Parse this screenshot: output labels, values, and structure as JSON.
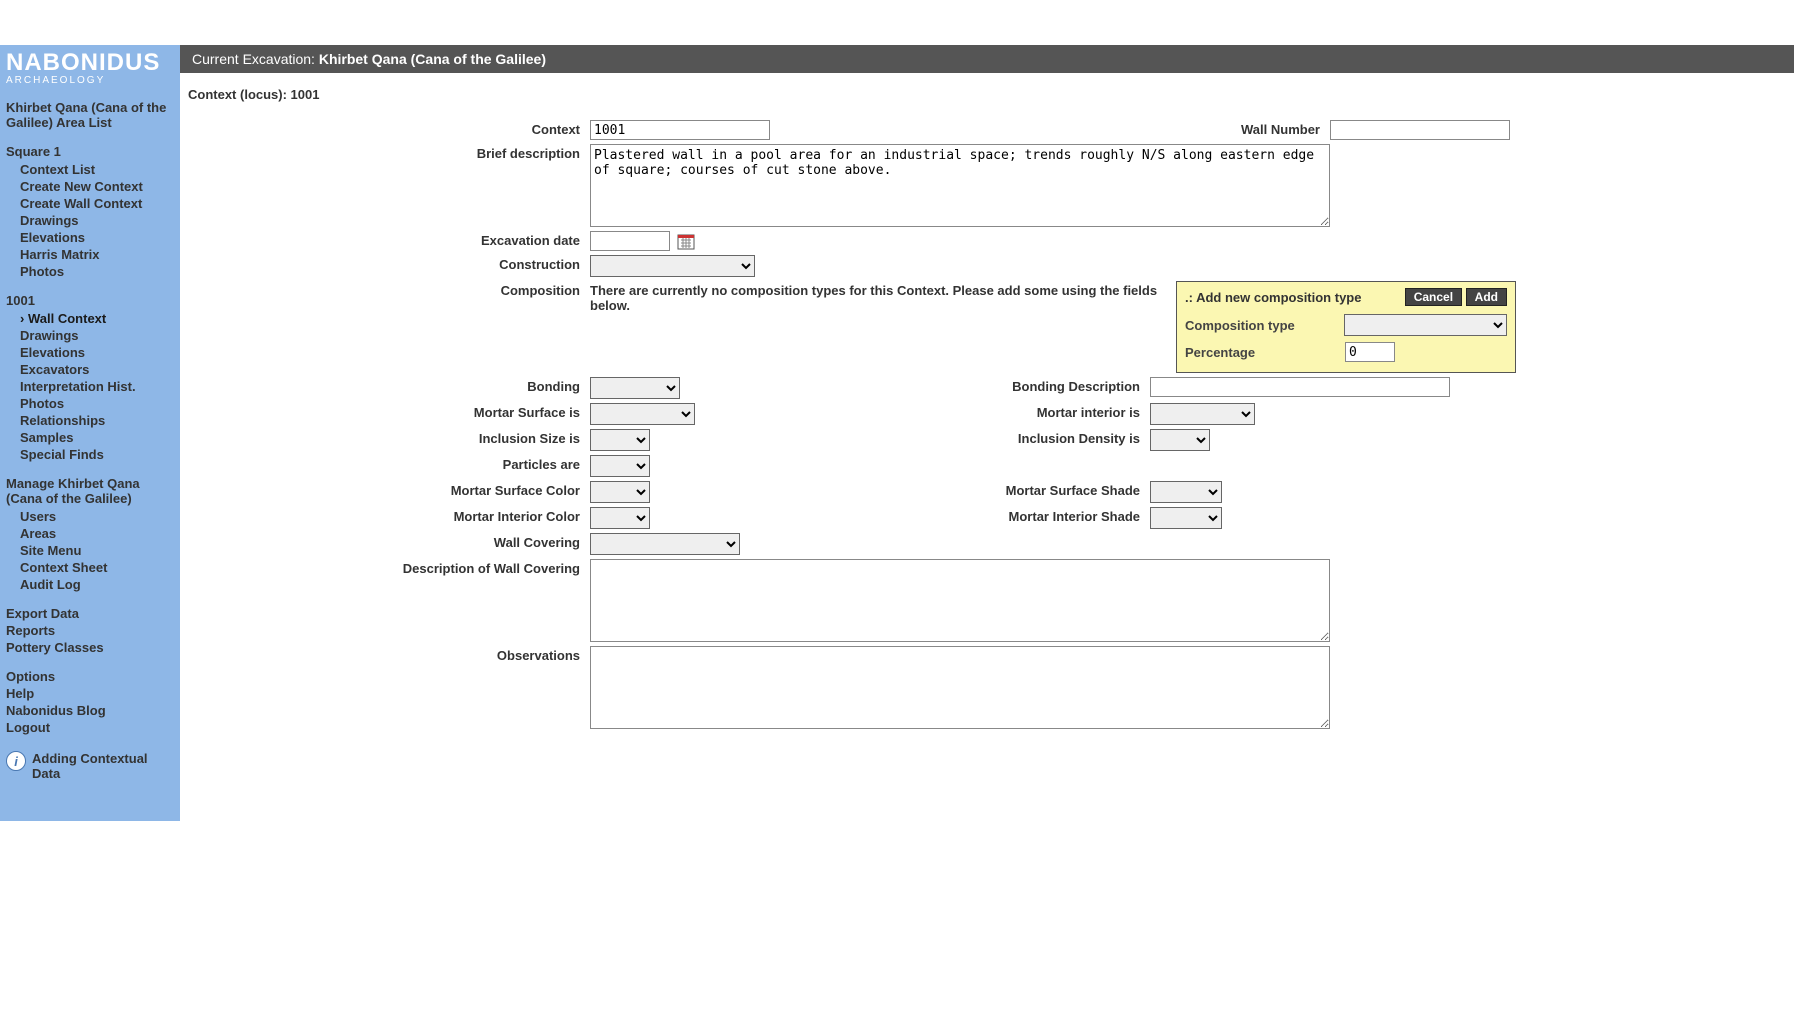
{
  "brand": {
    "name": "NABONIDUS",
    "sub": "ARCHAEOLOGY"
  },
  "topbar": {
    "prefix": "Current Excavation: ",
    "site": "Khirbet Qana (Cana of the Galilee)"
  },
  "context_title": "Context (locus): 1001",
  "sidebar": {
    "area_heading": "Khirbet Qana (Cana of the Galilee) Area List",
    "square_heading": "Square 1",
    "square_links": {
      "context_list": "Context List",
      "create_new_context": "Create New Context",
      "create_wall_context": "Create Wall Context",
      "drawings": "Drawings",
      "elevations": "Elevations",
      "harris_matrix": "Harris Matrix",
      "photos": "Photos"
    },
    "context_heading": "1001",
    "context_links": {
      "wall_context": "Wall Context",
      "drawings": "Drawings",
      "elevations": "Elevations",
      "excavators": "Excavators",
      "interp_hist": "Interpretation Hist.",
      "photos": "Photos",
      "relationships": "Relationships",
      "samples": "Samples",
      "special_finds": "Special Finds"
    },
    "manage_heading": "Manage Khirbet Qana (Cana of the Galilee)",
    "manage_links": {
      "users": "Users",
      "areas": "Areas",
      "site_menu": "Site Menu",
      "context_sheet": "Context Sheet",
      "audit_log": "Audit Log"
    },
    "global_links": {
      "export_data": "Export Data",
      "reports": "Reports",
      "pottery_classes": "Pottery Classes"
    },
    "footer_links": {
      "options": "Options",
      "help": "Help",
      "blog": "Nabonidus Blog",
      "logout": "Logout"
    },
    "info": "Adding Contextual Data"
  },
  "labels": {
    "context": "Context",
    "wall_number": "Wall Number",
    "brief_desc": "Brief description",
    "excavation_date": "Excavation date",
    "construction": "Construction",
    "composition": "Composition",
    "bonding": "Bonding",
    "bonding_desc": "Bonding Description",
    "mortar_surface_is": "Mortar Surface is",
    "mortar_interior_is": "Mortar interior is",
    "inclusion_size": "Inclusion Size is",
    "inclusion_density": "Inclusion Density is",
    "particles_are": "Particles are",
    "mortar_surface_color": "Mortar Surface Color",
    "mortar_surface_shade": "Mortar Surface Shade",
    "mortar_interior_color": "Mortar Interior Color",
    "mortar_interior_shade": "Mortar Interior Shade",
    "wall_covering": "Wall Covering",
    "desc_wall_covering": "Description of Wall Covering",
    "observations": "Observations"
  },
  "values": {
    "context": "1001",
    "wall_number": "",
    "brief_desc": "Plastered wall in a pool area for an industrial space; trends roughly N/S along eastern edge of square; courses of cut stone above.",
    "excavation_date": "",
    "construction": "",
    "bonding": "",
    "bonding_desc": "",
    "mortar_surface_is": "",
    "mortar_interior_is": "",
    "inclusion_size": "",
    "inclusion_density": "",
    "particles_are": "",
    "mortar_surface_color": "",
    "mortar_surface_shade": "",
    "mortar_interior_color": "",
    "mortar_interior_shade": "",
    "wall_covering": "",
    "desc_wall_covering": "",
    "observations": ""
  },
  "composition": {
    "empty_msg": "There are currently no composition types for this Context. Please add some using the fields below.",
    "panel_title": ".: Add new composition type",
    "cancel": "Cancel",
    "add": "Add",
    "type_label": "Composition type",
    "pct_label": "Percentage",
    "pct_value": "0"
  }
}
